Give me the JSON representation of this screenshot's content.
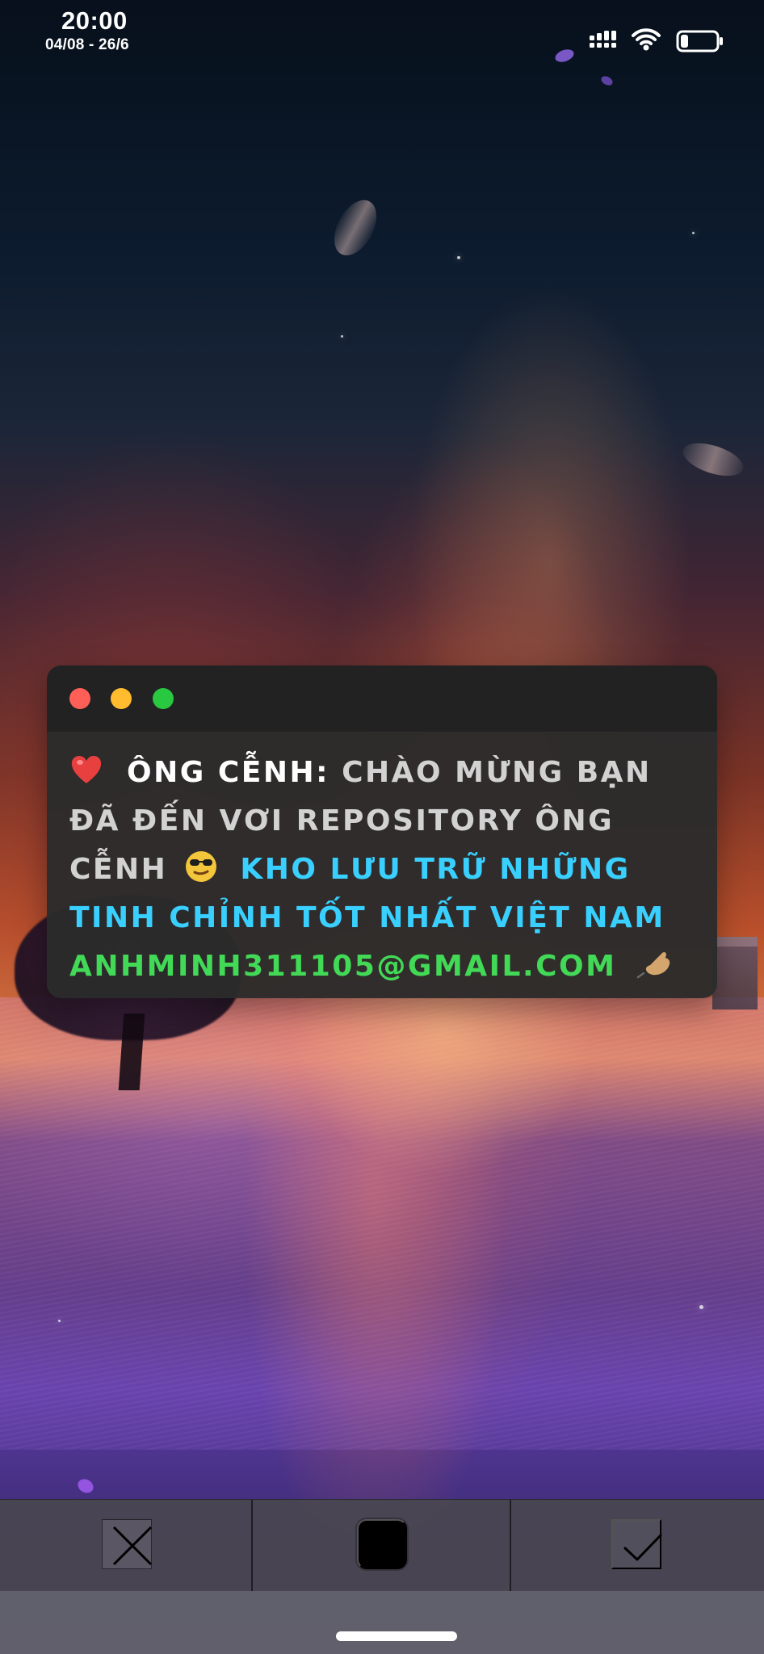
{
  "status_bar": {
    "time": "20:00",
    "date_range": "04/08 - 26/6",
    "icons": [
      "signal-icon",
      "wifi-icon",
      "battery-icon"
    ]
  },
  "card": {
    "window_controls": [
      "red-dot",
      "yellow-dot",
      "green-dot"
    ],
    "line_1": {
      "name": "ÔNG CỄNH:",
      "text": "CHÀO MỪNG BẠN"
    },
    "line_2": "ĐÃ ĐẾN VƠI REPOSITORY ÔNG",
    "line_3": {
      "text_before_icon": "CỄNH",
      "accent_text": "KHO LƯU TRỮ NHỮNG"
    },
    "line_4": "TINH CHỈNH TỐT NHẤT VIỆT NAM",
    "line_5": "ANHMINH311105@GMAIL.COM",
    "icons": [
      "heart-icon",
      "cool-face-icon",
      "writing-hand-icon"
    ]
  },
  "controls": {
    "cancel_icon": "close-icon",
    "color_icon": "color-swatch-icon",
    "confirm_icon": "checkmark-icon"
  },
  "colors": {
    "card_background": "#2b2b2b",
    "accent_blue": "#39cfff",
    "email_green": "#42d957",
    "selected_color": "#000000"
  }
}
